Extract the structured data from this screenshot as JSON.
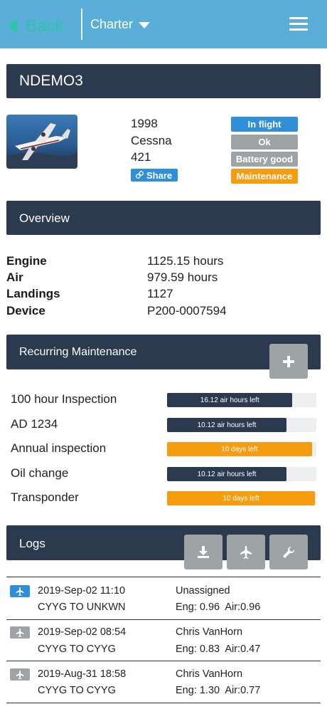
{
  "topbar": {
    "back_label": "Back",
    "charter_label": "Charter"
  },
  "aircraft": {
    "tail": "NDEMO3",
    "year": "1998",
    "make": "Cessna",
    "model": "421",
    "share_label": "Share",
    "badges": [
      {
        "label": "In flight",
        "color": "#2f8fd8"
      },
      {
        "label": "Ok",
        "color": "#9ea3a6"
      },
      {
        "label": "Battery good",
        "color": "#9ea3a6"
      },
      {
        "label": "Maintenance",
        "color": "#f59c11"
      }
    ]
  },
  "overview": {
    "title": "Overview",
    "rows": [
      {
        "label": "Engine",
        "value": "1125.15 hours"
      },
      {
        "label": "Air",
        "value": "979.59 hours"
      },
      {
        "label": "Landings",
        "value": "1127"
      },
      {
        "label": "Device",
        "value": "P200-0007594"
      }
    ]
  },
  "maintenance": {
    "title": "Recurring Maintenance",
    "add_icon": "plus-icon",
    "items": [
      {
        "label": "100 hour Inspection",
        "status": "16.12 air hours left",
        "progress": 0.84,
        "color": "#2b3a4f"
      },
      {
        "label": "AD 1234",
        "status": "10.12 air hours left",
        "progress": 0.8,
        "color": "#2b3a4f"
      },
      {
        "label": "Annual inspection",
        "status": "10 days left",
        "progress": 0.97,
        "color": "#f59c11"
      },
      {
        "label": "Oil change",
        "status": "10.12 air hours left",
        "progress": 0.8,
        "color": "#2b3a4f"
      },
      {
        "label": "Transponder",
        "status": "10 days left",
        "progress": 0.99,
        "color": "#f59c11"
      }
    ]
  },
  "logs": {
    "title": "Logs",
    "action_icons": [
      "download-icon",
      "airplane-icon",
      "wrench-icon"
    ],
    "entries": [
      {
        "datetime": "2019-Sep-02 11:10",
        "route": "CYYG TO UNKWN",
        "pilot": "Unassigned",
        "times": "Eng: 0.96  Air:0.96",
        "icon_color": "#2f8fd8"
      },
      {
        "datetime": "2019-Sep-02 08:54",
        "route": "CYYG TO CYYG",
        "pilot": "Chris VanHorn",
        "times": "Eng: 0.83  Air:0.47",
        "icon_color": "#9ea3a6"
      },
      {
        "datetime": "2019-Aug-31 18:58",
        "route": "CYYG TO CYYG",
        "pilot": "Chris VanHorn",
        "times": "Eng: 1.30  Air:0.77",
        "icon_color": "#9ea3a6"
      }
    ]
  },
  "colors": {
    "header": "#5aaed8",
    "section": "#2b3a4f",
    "accent": "#2ec4a8",
    "warning": "#f59c11",
    "info": "#2f8fd8",
    "muted": "#9ea3a6"
  }
}
